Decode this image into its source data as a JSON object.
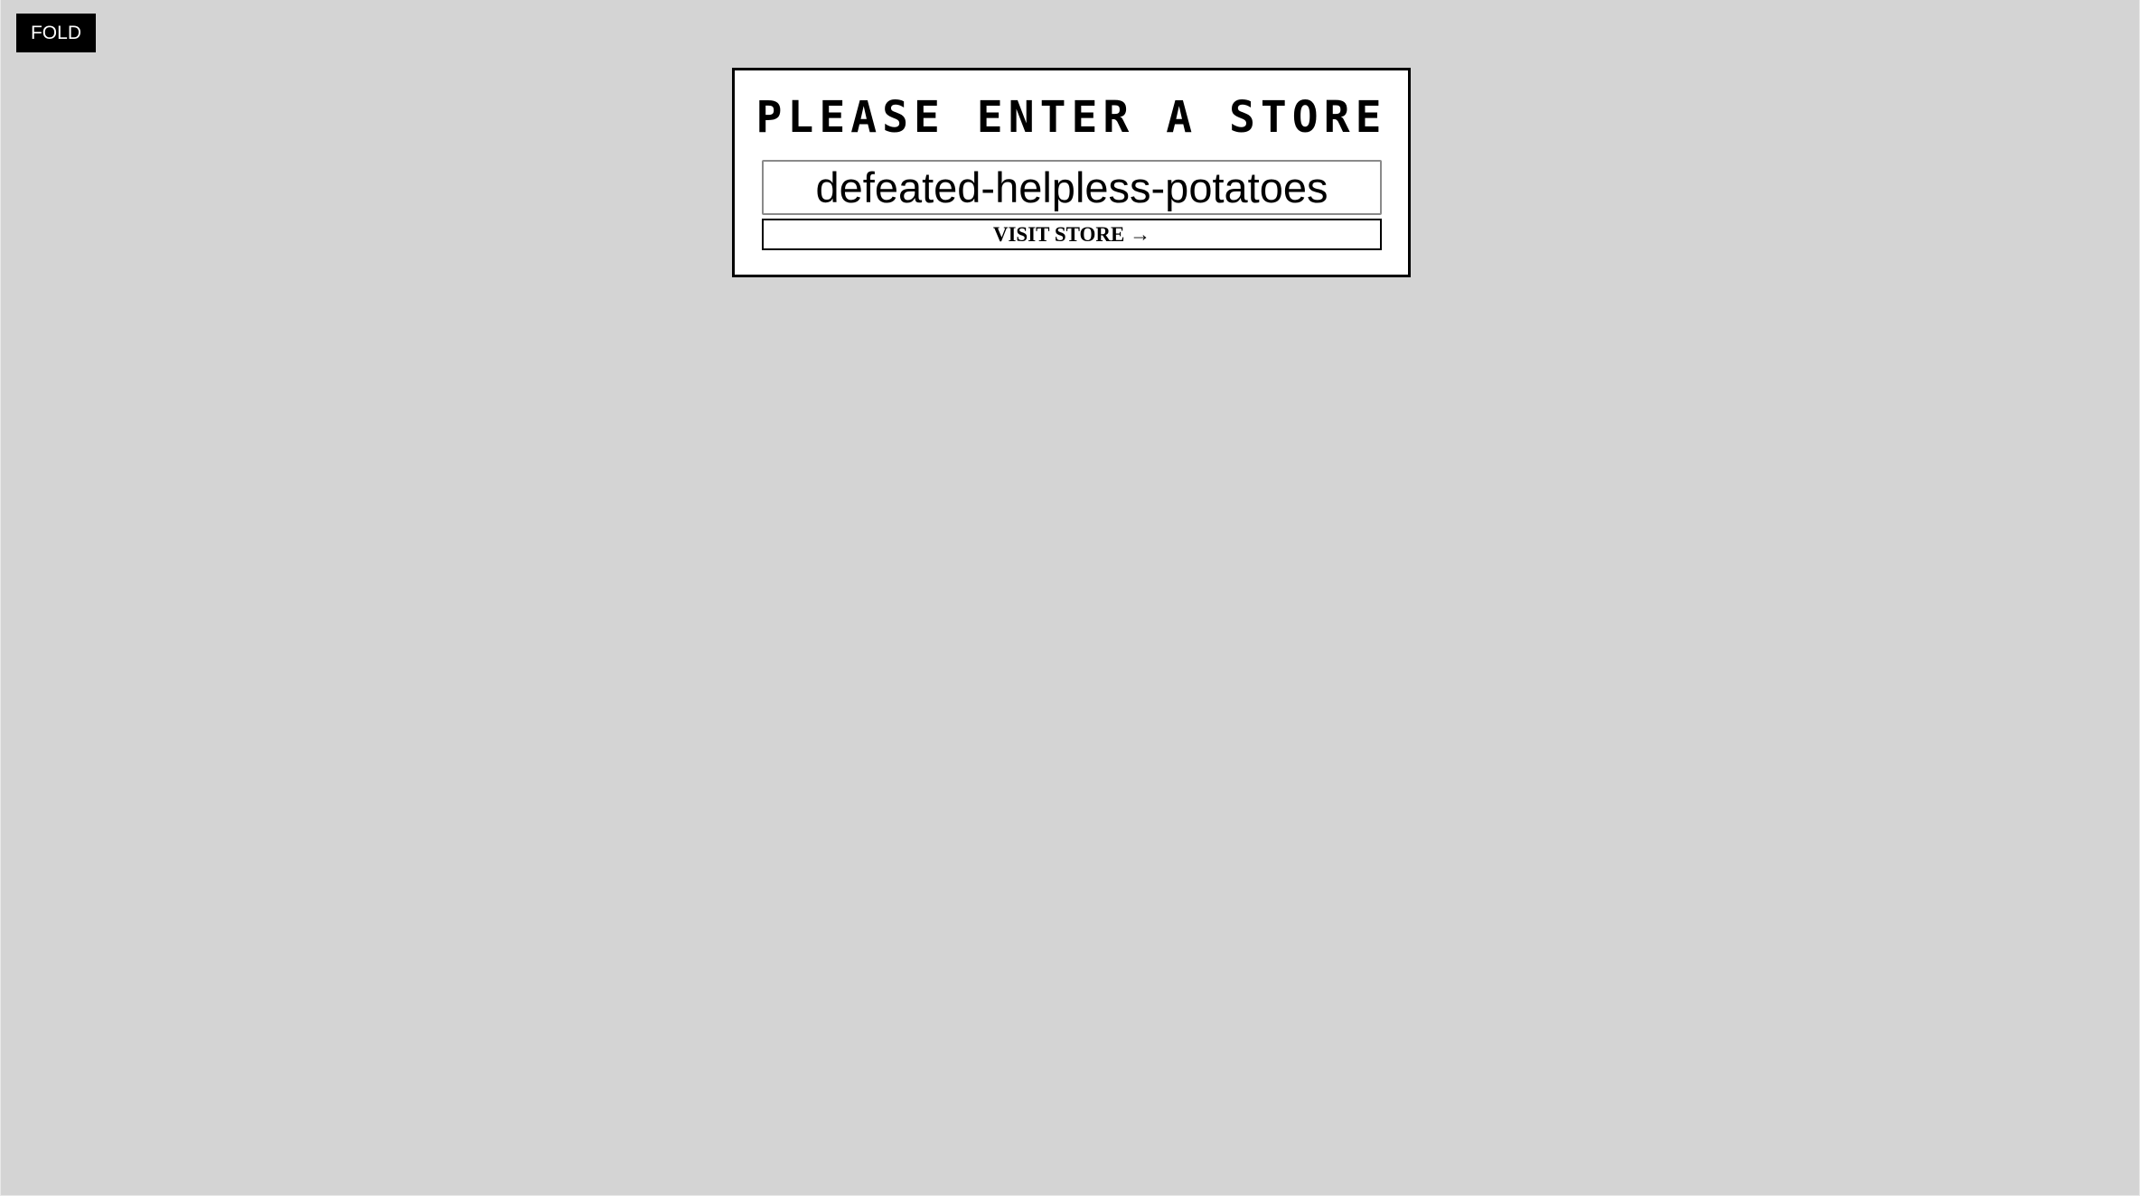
{
  "fold_button": {
    "label": "FOLD"
  },
  "store_panel": {
    "title": "PLEASE ENTER A STORE",
    "input_value": "defeated-helpless-potatoes",
    "visit_label": "VISIT STORE →"
  },
  "colors": {
    "background": "#d4d4d4",
    "panel": "#ffffff",
    "border": "#000000",
    "fold_button_bg": "#000000",
    "fold_button_text": "#ffffff"
  }
}
